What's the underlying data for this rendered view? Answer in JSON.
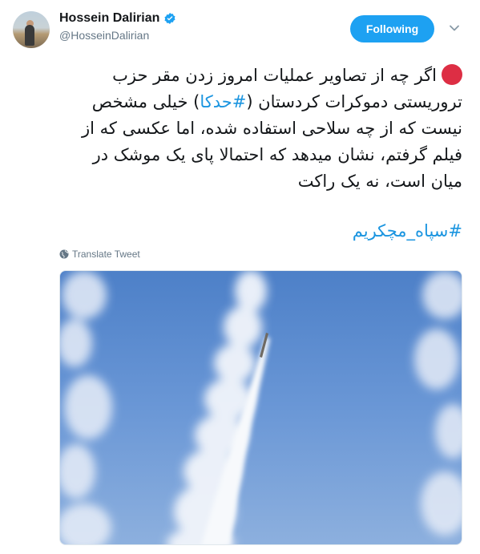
{
  "author": {
    "name": "Hossein Dalirian",
    "handle": "@HosseinDalirian",
    "verified": true
  },
  "follow_button": {
    "label": "Following"
  },
  "tweet": {
    "line1": "اگر چه از تصاویر عملیات امروز زدن مقر حزب",
    "line2_a": "تروریستی دموکرات کردستان (",
    "line2_tag": "#حدکا",
    "line2_b": ") خیلی مشخص",
    "line3": "نیست که از چه سلاحی استفاده شده، اما عکسی که از",
    "line4": "فیلم گرفتم، نشان میدهد که احتمالا پای یک موشک در",
    "line5": "میان است، نه یک راکت",
    "hashtag_line": "#سپاه_مچکریم"
  },
  "translate": {
    "label": "Translate Tweet"
  },
  "colors": {
    "accent": "#1da1f2",
    "red_dot": "#dd2e44",
    "link": "#1b95e0"
  },
  "icons": {
    "verified": "verified-badge-icon",
    "caret": "chevron-down-icon",
    "globe": "globe-icon"
  }
}
